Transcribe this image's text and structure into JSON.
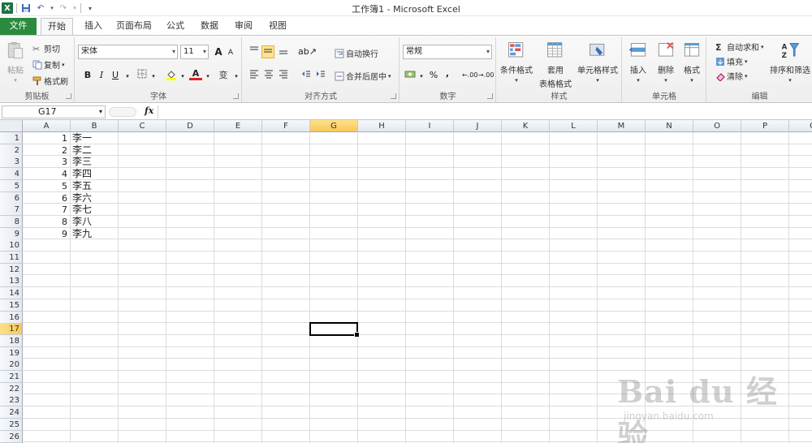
{
  "window": {
    "title": "工作簿1 - Microsoft Excel"
  },
  "tabs": [
    "文件",
    "开始",
    "插入",
    "页面布局",
    "公式",
    "数据",
    "审阅",
    "视图"
  ],
  "ribbon": {
    "clipboard": {
      "paste": "粘贴",
      "cut": "剪切",
      "copy": "复制",
      "format_painter": "格式刷",
      "label": "剪贴板"
    },
    "font": {
      "name": "宋体",
      "size": "11",
      "label": "字体",
      "bold": "B",
      "italic": "I",
      "underline": "U",
      "grow": "A",
      "shrink": "A",
      "phonetic": "变"
    },
    "alignment": {
      "wrap": "自动换行",
      "merge": "合并后居中",
      "label": "对齐方式"
    },
    "number": {
      "format": "常规",
      "percent": "%",
      "comma": ",",
      "inc_dec": ".00",
      "dec_dec": ".00",
      "label": "数字"
    },
    "styles": {
      "conditional": "条件格式",
      "table_format_1": "套用",
      "table_format_2": "表格格式",
      "cell_styles": "单元格样式",
      "label": "样式"
    },
    "cells": {
      "insert": "插入",
      "delete": "删除",
      "format": "格式",
      "label": "单元格"
    },
    "editing": {
      "autosum": "自动求和",
      "fill": "填充",
      "clear": "清除",
      "sort_filter": "排序和筛选",
      "label": "编辑"
    }
  },
  "formula_bar": {
    "name_box": "G17",
    "fx": "fx",
    "value": ""
  },
  "sheet": {
    "columns": [
      "A",
      "B",
      "C",
      "D",
      "E",
      "F",
      "G",
      "H",
      "I",
      "J",
      "K",
      "L",
      "M",
      "N",
      "O",
      "P",
      "Q"
    ],
    "rows": [
      "1",
      "2",
      "3",
      "4",
      "5",
      "6",
      "7",
      "8",
      "9",
      "10",
      "11",
      "12",
      "13",
      "14",
      "15",
      "16",
      "17",
      "18",
      "19",
      "20",
      "21",
      "22",
      "23",
      "24",
      "25",
      "26"
    ],
    "active_column": "G",
    "active_row": "17",
    "data": [
      {
        "a": "1",
        "b": "李一"
      },
      {
        "a": "2",
        "b": "李二"
      },
      {
        "a": "3",
        "b": "李三"
      },
      {
        "a": "4",
        "b": "李四"
      },
      {
        "a": "5",
        "b": "李五"
      },
      {
        "a": "6",
        "b": "李六"
      },
      {
        "a": "7",
        "b": "李七"
      },
      {
        "a": "8",
        "b": "李八"
      },
      {
        "a": "9",
        "b": "李九"
      }
    ]
  },
  "watermark": {
    "brand": "Bai du 经验",
    "url": "jingyan.baidu.com"
  },
  "colors": {
    "file_tab": "#2a8a3e",
    "active_header": "#f7c85a",
    "excel_green": "#1f7244"
  }
}
